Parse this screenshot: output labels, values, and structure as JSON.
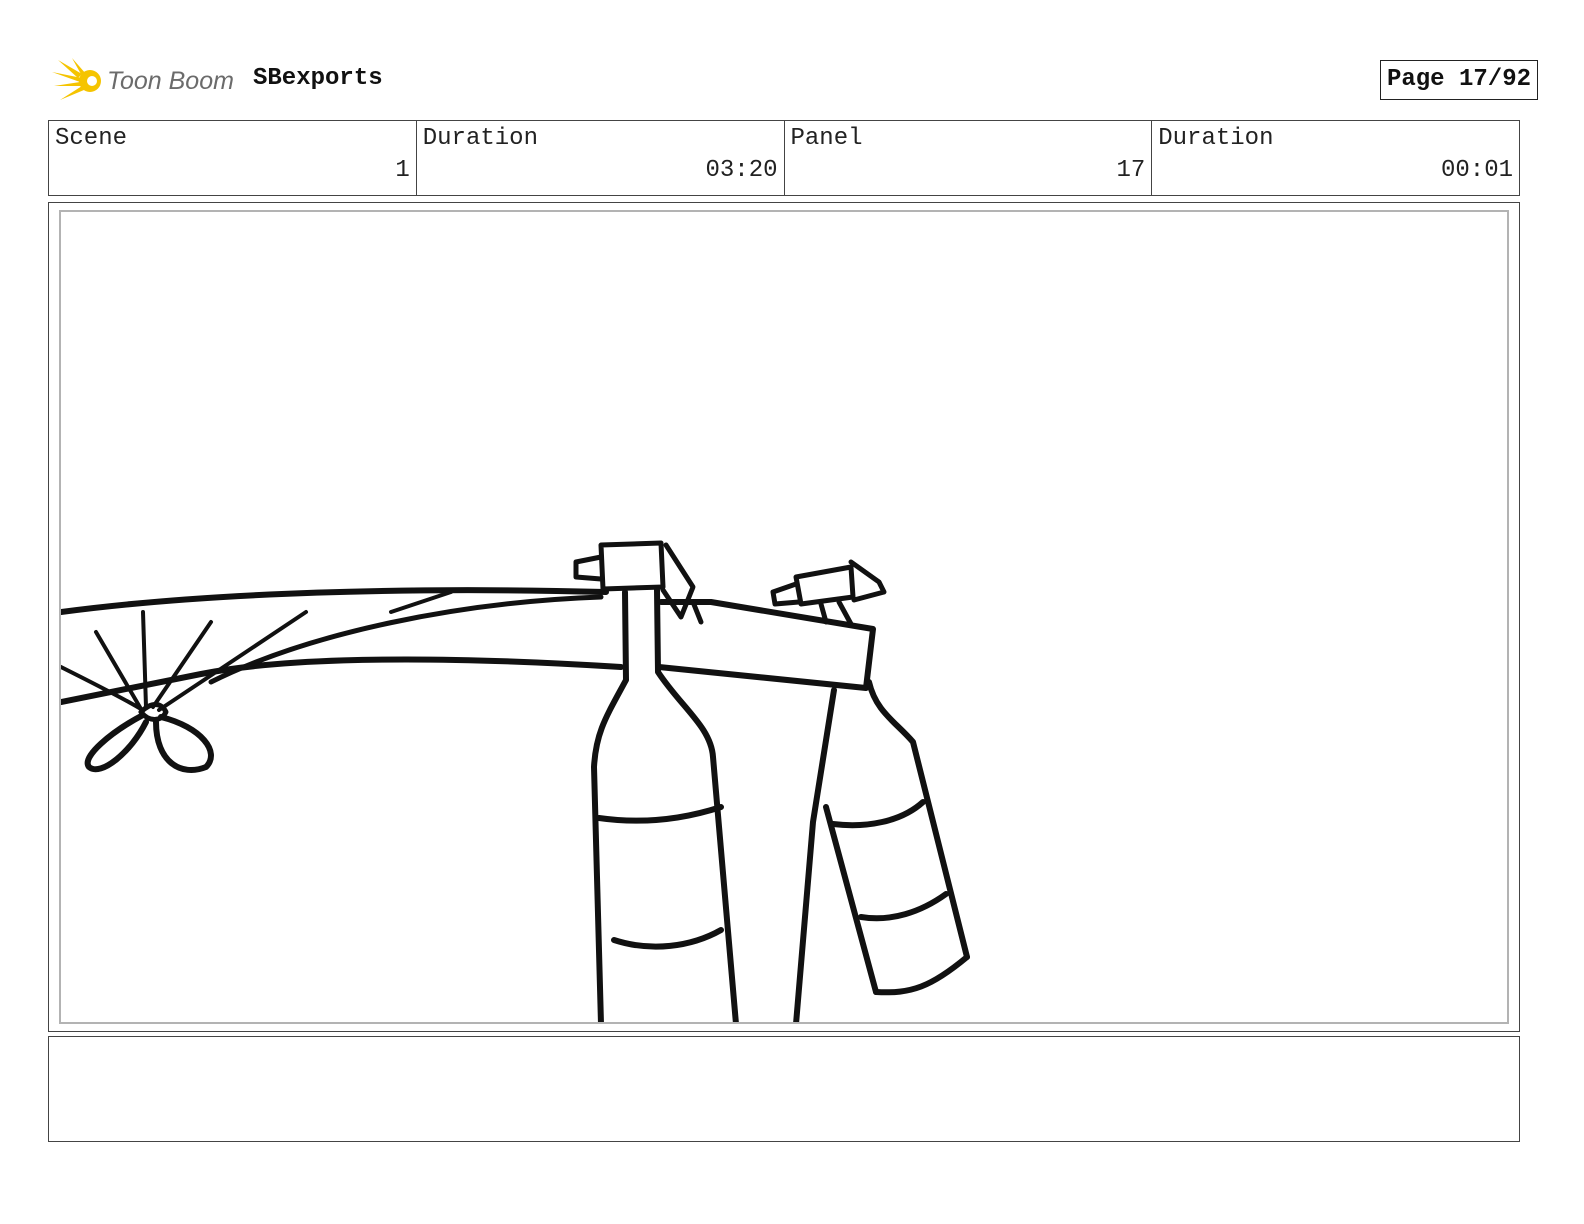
{
  "header": {
    "logo_text": "Toon Boom",
    "project_title": "SBexports",
    "page_label": "Page 17/92"
  },
  "info": [
    {
      "label": "Scene",
      "value": "1"
    },
    {
      "label": "Duration",
      "value": "03:20"
    },
    {
      "label": "Panel",
      "value": "17"
    },
    {
      "label": "Duration",
      "value": "00:01"
    }
  ],
  "panel": {
    "drawing": "sketch of a rope tied in a bow at left, stretched across to two hanging bottles with spray nozzles"
  },
  "notes": {
    "text": ""
  },
  "colors": {
    "logo_star": "#f5c400",
    "logo_text": "#6b6b6b",
    "frame_border": "#444444",
    "panel_border": "#b3b3b3"
  }
}
